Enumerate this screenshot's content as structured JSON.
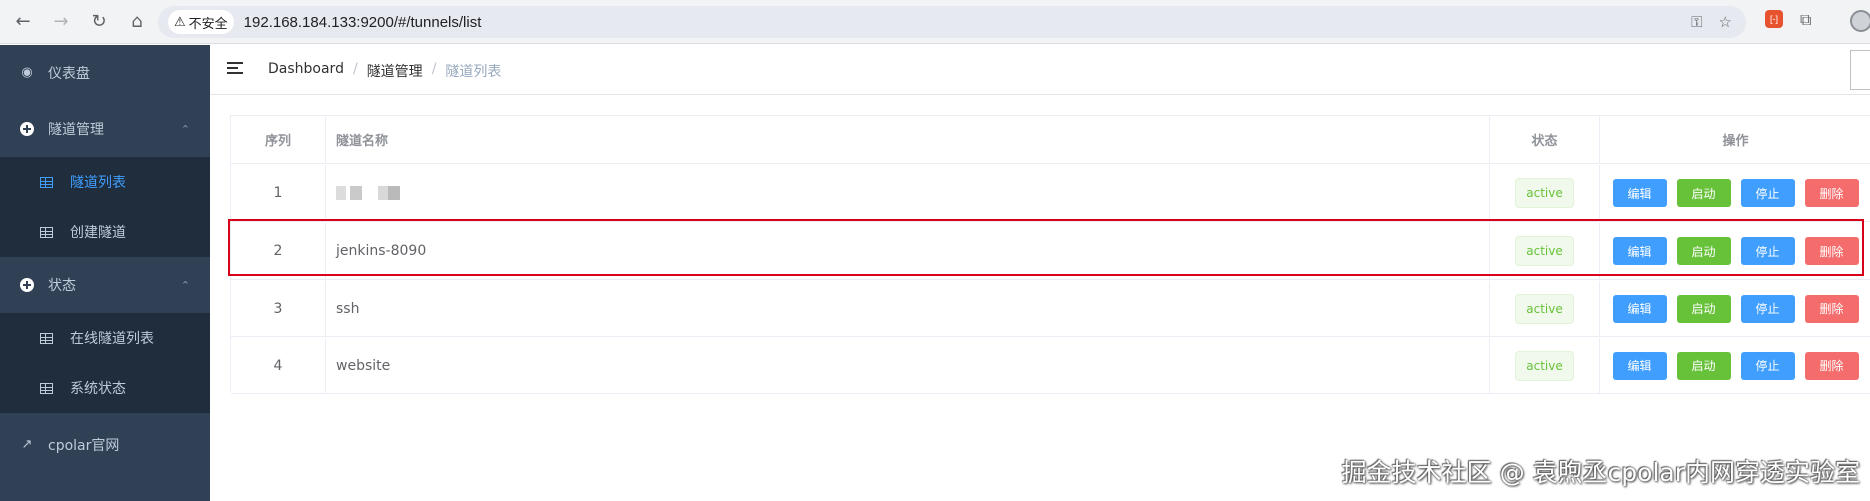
{
  "browser": {
    "security_label": "不安全",
    "url": "192.168.184.133:9200/#/tunnels/list"
  },
  "sidebar": {
    "items": [
      {
        "label": "仪表盘",
        "icon": "dashboard-icon"
      },
      {
        "label": "隧道管理",
        "icon": "plus-circle-icon",
        "expanded": true,
        "children": [
          {
            "label": "隧道列表",
            "active": true
          },
          {
            "label": "创建隧道",
            "active": false
          }
        ]
      },
      {
        "label": "状态",
        "icon": "plus-circle-icon",
        "expanded": true,
        "children": [
          {
            "label": "在线隧道列表"
          },
          {
            "label": "系统状态"
          }
        ]
      },
      {
        "label": "cpolar官网",
        "icon": "external-link-icon"
      }
    ]
  },
  "breadcrumb": [
    "Dashboard",
    "隧道管理",
    "隧道列表"
  ],
  "table": {
    "columns": [
      "序列",
      "隧道名称",
      "状态",
      "操作"
    ],
    "rows": [
      {
        "index": "1",
        "name": "",
        "status": "active"
      },
      {
        "index": "2",
        "name": "jenkins-8090",
        "status": "active"
      },
      {
        "index": "3",
        "name": "ssh",
        "status": "active"
      },
      {
        "index": "4",
        "name": "website",
        "status": "active"
      }
    ],
    "actions": {
      "edit": "编辑",
      "start": "启动",
      "stop": "停止",
      "delete": "删除"
    }
  },
  "watermark": "掘金技术社区 @ 袁煦丞cpolar内网穿透实验室",
  "colors": {
    "sidebar_bg": "#304156",
    "active": "#409eff",
    "success": "#67c23a",
    "danger": "#f56c6c",
    "highlight": "#d9001b"
  }
}
